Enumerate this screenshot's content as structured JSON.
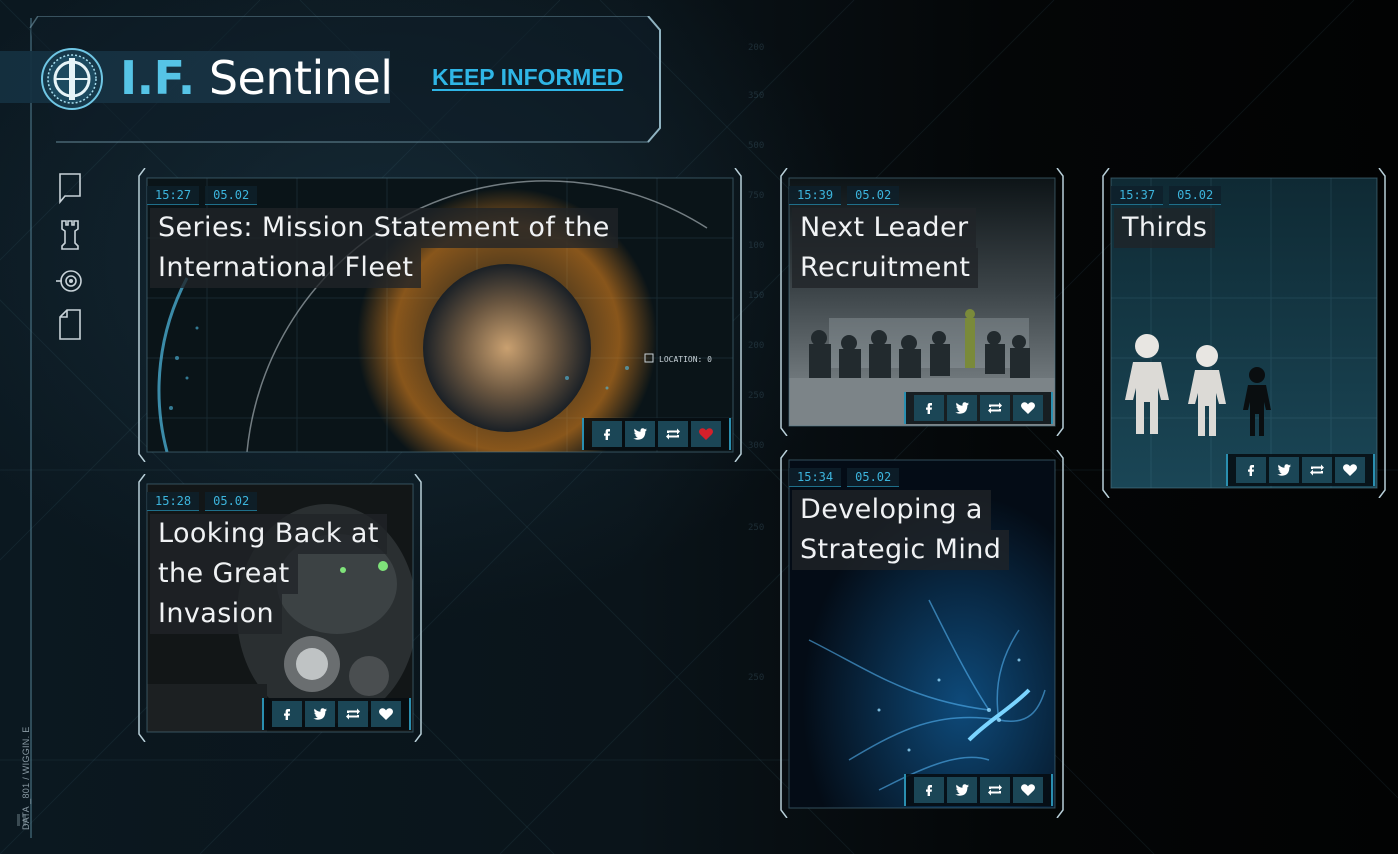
{
  "header": {
    "logo_prefix": "I.F.",
    "logo_name": "Sentinel",
    "keep_informed": "KEEP INFORMED"
  },
  "sidebar": {
    "icons": [
      "speech-bubble-icon",
      "rook-tower-icon",
      "target-eye-icon",
      "document-icon"
    ],
    "footer_label": "DATA _801 / WIGGIN. E"
  },
  "share_buttons": [
    "facebook-icon",
    "twitter-icon",
    "retweet-icon",
    "heart-icon"
  ],
  "colors": {
    "accent": "#2fb6e6",
    "timestamp": "#3cb4dc",
    "liked_heart": "#d4202a",
    "button_bg": "#1b4656"
  },
  "cards": [
    {
      "time": "15:27",
      "date": "05.02",
      "title_lines": [
        "Series: Mission Statement of the",
        "International Fleet"
      ],
      "image_label": "LOCATION: 0",
      "liked": true
    },
    {
      "time": "15:39",
      "date": "05.02",
      "title_lines": [
        "Next Leader",
        "Recruitment"
      ],
      "liked": false
    },
    {
      "time": "15:37",
      "date": "05.02",
      "title_lines": [
        "Thirds"
      ],
      "liked": false
    },
    {
      "time": "15:28",
      "date": "05.02",
      "title_lines": [
        "Looking Back at",
        "the Great",
        "Invasion"
      ],
      "liked": false
    },
    {
      "time": "15:34",
      "date": "05.02",
      "title_lines": [
        "Developing a",
        "Strategic Mind"
      ],
      "liked": false
    }
  ]
}
